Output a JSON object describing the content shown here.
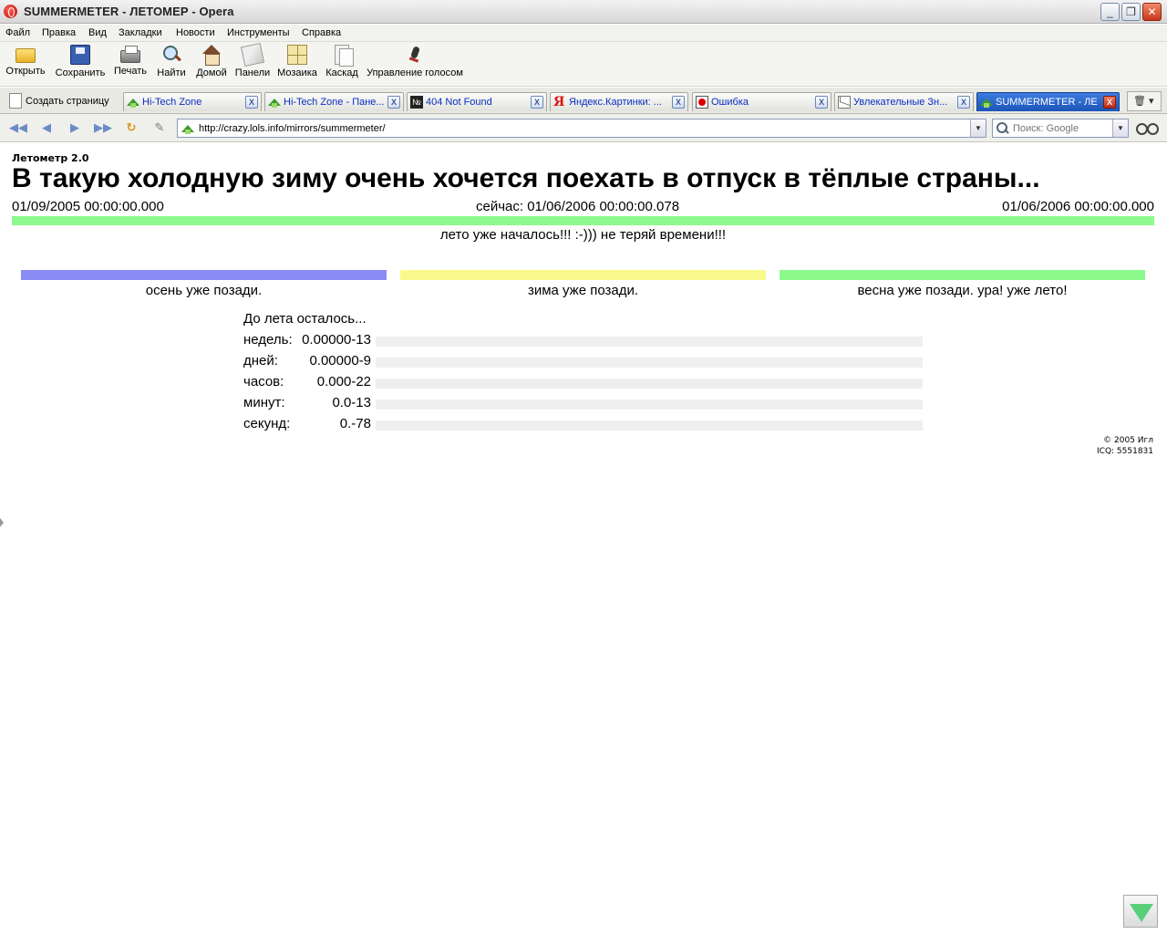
{
  "window": {
    "title": "SUMMERMETER - ЛЕТОМЕР - Opera",
    "minimize": "_",
    "maximize": "❐",
    "close": "✕"
  },
  "menu": [
    "Файл",
    "Правка",
    "Вид",
    "Закладки",
    "Новости",
    "Инструменты",
    "Справка"
  ],
  "toolbar": {
    "open": "Открыть",
    "save": "Сохранить",
    "print": "Печать",
    "find": "Найти",
    "home": "Домой",
    "panels": "Панели",
    "tile": "Мозаика",
    "cascade": "Каскад",
    "voice": "Управление голосом"
  },
  "tabs": {
    "new_page": "Создать страницу",
    "items": [
      {
        "label": "Hi-Tech Zone",
        "icon": "green-house-icon"
      },
      {
        "label": "Hi-Tech Zone - Пане...",
        "icon": "green-house-icon"
      },
      {
        "label": "404 Not Found",
        "icon": "number-sign-icon"
      },
      {
        "label": "Яндекс.Картинки: ...",
        "icon": "yandex-icon"
      },
      {
        "label": "Ошибка",
        "icon": "error-icon"
      },
      {
        "label": "Увлекательные Зн...",
        "icon": "envelope-icon"
      },
      {
        "label": "SUMMERMETER - ЛЕ...",
        "icon": "green-house-icon",
        "active": true
      }
    ],
    "close_glyph": "X",
    "trash_glyph": "▾"
  },
  "address": {
    "url": "http://crazy.lols.info/mirrors/summermeter/",
    "search_placeholder": "Поиск: Google",
    "dropdown_glyph": "▼"
  },
  "nav": {
    "rewind": "◀◀",
    "back": "◀",
    "forward": "▶",
    "fastforward": "▶▶",
    "reload": "↻",
    "edit": "✎"
  },
  "page": {
    "app_name": "Летометр 2.0",
    "headline": "В такую холодную зиму очень хочется поехать в отпуск в тёплые страны...",
    "start_date": "01/09/2005 00:00:00.000",
    "now_label": "сейчас: 01/06/2006 00:00:00.078",
    "end_date": "01/06/2006 00:00:00.000",
    "main_progress": 1.0,
    "main_bar_color": "#8cfa8c",
    "message": "лето уже началось!!! :-))) не теряй времени!!!",
    "seasons": [
      {
        "label": "осень уже позади.",
        "color": "#8a8af5",
        "progress": 1.0
      },
      {
        "label": "зима уже позади.",
        "color": "#fafa8c",
        "progress": 1.0
      },
      {
        "label": "весна уже позади. ура! уже лето!",
        "color": "#8cfa8c",
        "progress": 1.0
      }
    ],
    "countdown_title": "До лета осталось...",
    "countdown": [
      {
        "label": "недель:",
        "value": "0.00000-13"
      },
      {
        "label": "дней:",
        "value": "0.00000-9"
      },
      {
        "label": "часов:",
        "value": "0.000-22"
      },
      {
        "label": "минут:",
        "value": "0.0-13"
      },
      {
        "label": "секунд:",
        "value": "0.-78"
      }
    ],
    "copyright": "© 2005 Игл",
    "icq": "ICQ: 5551831"
  }
}
